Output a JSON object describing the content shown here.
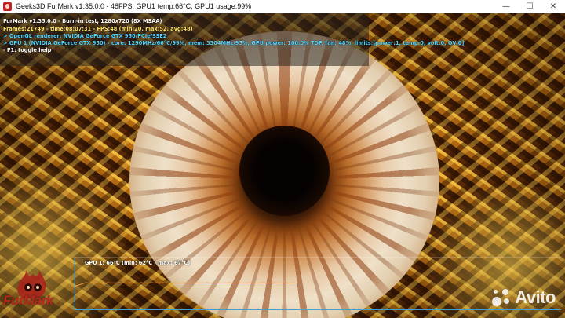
{
  "window": {
    "title": "Geeks3D FurMark v1.35.0.0 - 48FPS, GPU1 temp:66°C, GPU1 usage:99%",
    "controls": {
      "minimize": "—",
      "maximize": "☐",
      "close": "✕"
    }
  },
  "osd": {
    "line1": "FurMark v1.35.0.0 - Burn-in test, 1280x720 (8X MSAA)",
    "line2": "Frames:21749 - time:08:07:31 - FPS:48 (min:20, max:52, avg:48)",
    "line3": "> OpenGL renderer: NVIDIA GeForce GTX 950/PCIe/SSE2",
    "line4": "> GPU 1 (NVIDIA GeForce GTX 950) - core: 1290MHz/66°C/99%, mem: 3304MHz/95%, GPU power: 100.0% TDP, fan: 48%, limits:[power:1, temp:0, volt:0, OV:0]",
    "line5": "- F1: toggle help"
  },
  "graph": {
    "label": "GPU 1: 66°C (min: 62°C - max: 67°C)",
    "temp_min": 62,
    "temp_max": 67,
    "temp_current": 66,
    "line_color": "#f2a23c"
  },
  "logo": {
    "text": "FurMark",
    "color": "#b8281d"
  },
  "watermark": {
    "text": "Avito"
  },
  "colors": {
    "osd_yellow": "#ffe26a",
    "osd_cyan": "#4fd2ff",
    "graph_axis": "#3ea0d8"
  }
}
